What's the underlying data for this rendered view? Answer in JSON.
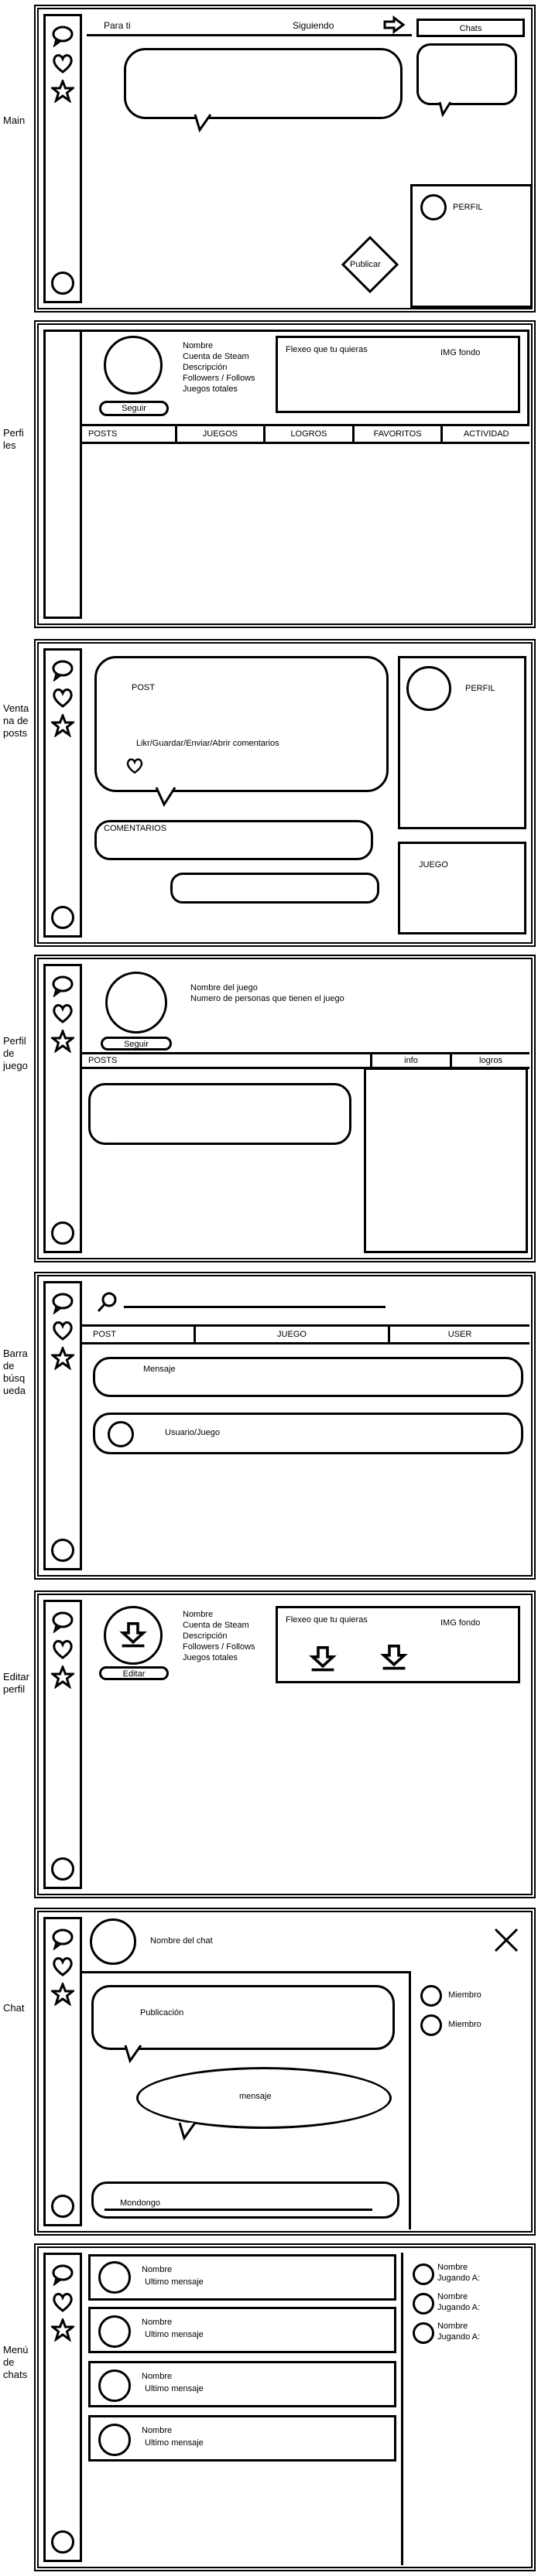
{
  "screens": {
    "main": {
      "label": "Main",
      "tab_for_you": "Para ti",
      "tab_following": "Siguiendo",
      "chats": "Chats",
      "profile": "PERFIL",
      "publish": "Publicar"
    },
    "profiles": {
      "label": "Perfi les",
      "info": [
        "Nombre",
        "Cuenta de Steam",
        "Descripción",
        "Followers / Follows",
        "Juegos totales"
      ],
      "follow": "Seguir",
      "flex": "Flexeo que tu quieras",
      "img_bg": "IMG fondo",
      "tabs": [
        "POSTS",
        "JUEGOS",
        "LOGROS",
        "FAVORITOS",
        "ACTIVIDAD"
      ]
    },
    "posts": {
      "label": "Venta na de posts",
      "post": "POST",
      "actions": "Likr/Guardar/Enviar/Abrir comentarios",
      "comments": "COMENTARIOS",
      "profile": "PERFIL",
      "game": "JUEGO"
    },
    "game_profile": {
      "label": "Perfil de juego",
      "name": "Nombre del juego",
      "players": "Numero de personas que tienen el juego",
      "follow": "Seguir",
      "posts": "POSTS",
      "info": "info",
      "achievements": "logros"
    },
    "search": {
      "label": "Barra de búsq ueda",
      "tabs": [
        "POST",
        "JUEGO",
        "USER"
      ],
      "message": "Mensaje",
      "user_game": "Usuario/Juego"
    },
    "edit_profile": {
      "label": "Editar perfil",
      "info": [
        "Nombre",
        "Cuenta de Steam",
        "Descripción",
        "Followers / Follows",
        "Juegos totales"
      ],
      "edit": "Editar",
      "flex": "Flexeo que tu quieras",
      "img_bg": "IMG fondo"
    },
    "chat": {
      "label": "Chat",
      "chat_name": "Nombre del chat",
      "publication": "Publicación",
      "message": "mensaje",
      "input": "Mondongo",
      "members": [
        "Miembro",
        "Miembro"
      ]
    },
    "chat_menu": {
      "label": "Menú de chats",
      "chats": [
        {
          "name": "Nombre",
          "last": "Ultimo mensaje"
        },
        {
          "name": "Nombre",
          "last": "Ultimo mensaje"
        },
        {
          "name": "Nombre",
          "last": "Ultimo mensaje"
        },
        {
          "name": "Nombre",
          "last": "Ultimo mensaje"
        }
      ],
      "playing": [
        {
          "name": "Nombre",
          "status": "Jugando A:"
        },
        {
          "name": "Nombre",
          "status": "Jugando A:"
        },
        {
          "name": "Nombre",
          "status": "Jugando A:"
        }
      ]
    }
  }
}
